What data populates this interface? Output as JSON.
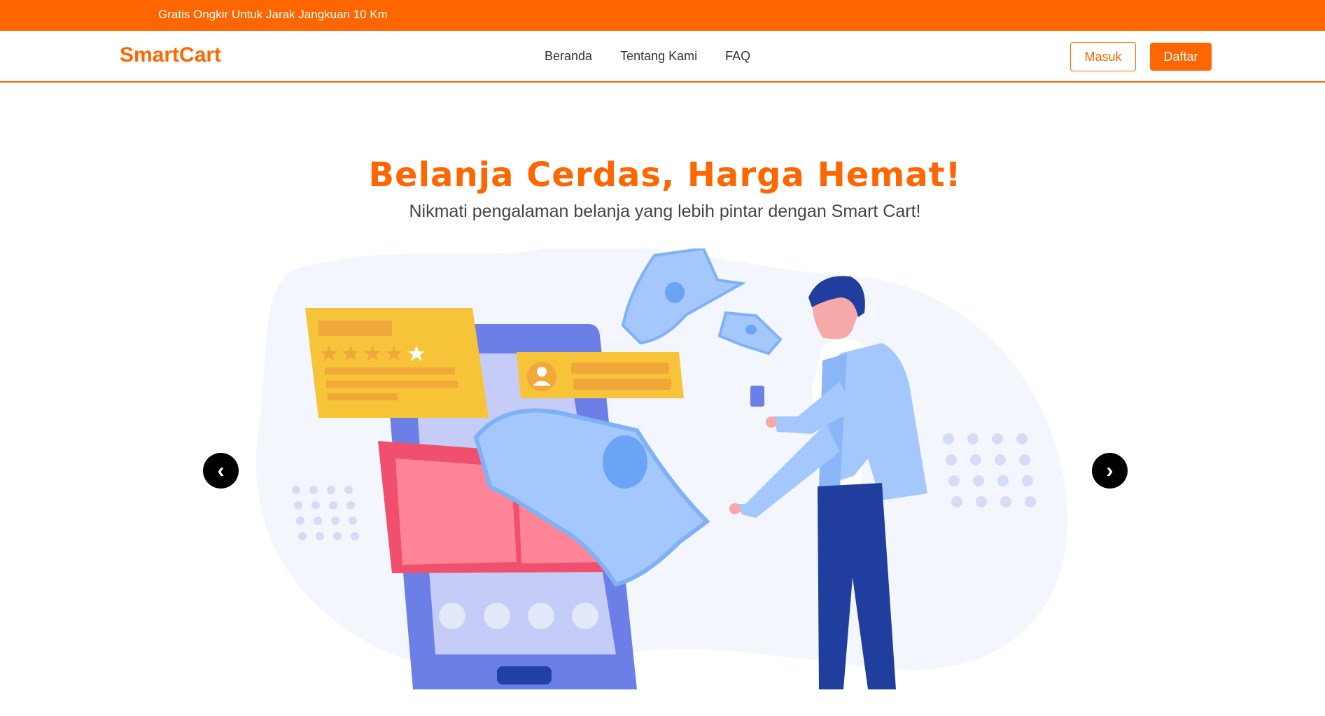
{
  "topbar": {
    "text": "Gratis Ongkir Untuk Jarak Jangkuan 10 Km"
  },
  "navbar": {
    "logo": "SmartCart",
    "links": [
      "Beranda",
      "Tentang Kami",
      "FAQ"
    ],
    "login_label": "Masuk",
    "register_label": "Daftar"
  },
  "hero": {
    "title": "Belanja Cerdas, Harga Hemat!",
    "subtitle": "Nikmati pengalaman belanja yang lebih pintar dengan Smart Cart!",
    "illustration": "shopping-illustration"
  },
  "carousel": {
    "prev_icon": "‹",
    "next_icon": "›"
  },
  "colors": {
    "brand": "#ff6600",
    "text": "#333333"
  }
}
